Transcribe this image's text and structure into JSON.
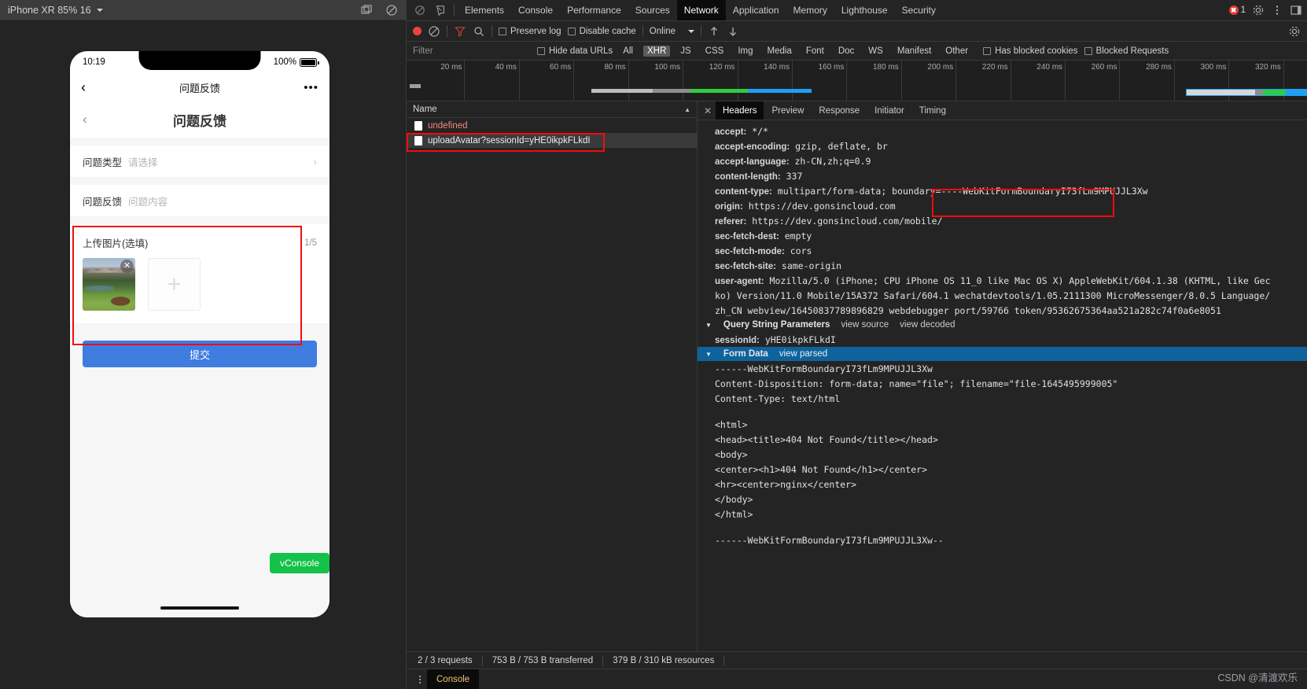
{
  "device_toolbar": {
    "device_label": "iPhone XR 85% 16",
    "rotate_icon": "rotate-icon",
    "screenshot_icon": "screenshot-icon",
    "no_throttle_icon": "no-throttling-icon"
  },
  "phone": {
    "status": {
      "time": "10:19",
      "battery_percent": "100%"
    },
    "wechat_nav": {
      "back": "‹",
      "title": "问题反馈",
      "menu": "•••"
    },
    "page": {
      "back": "‹",
      "title": "问题反馈",
      "rows": [
        {
          "label": "问题类型",
          "value": "请选择",
          "chevron": "›"
        },
        {
          "label": "问题反馈",
          "value": "问题内容",
          "chevron": ""
        }
      ],
      "upload": {
        "title": "上传图片(选填)",
        "count": "1/5",
        "remove_icon": "✕",
        "add_icon": "+"
      },
      "submit_label": "提交",
      "vconsole_label": "vConsole"
    }
  },
  "devtools": {
    "tabs": [
      {
        "label": "Elements",
        "active": false
      },
      {
        "label": "Console",
        "active": false
      },
      {
        "label": "Performance",
        "active": false
      },
      {
        "label": "Sources",
        "active": false
      },
      {
        "label": "Network",
        "active": true
      },
      {
        "label": "Application",
        "active": false
      },
      {
        "label": "Memory",
        "active": false
      },
      {
        "label": "Lighthouse",
        "active": false
      },
      {
        "label": "Security",
        "active": false
      }
    ],
    "error_count": "1",
    "inspect_icon": "inspect-icon",
    "device_toggle_icon": "device-toolbar-icon",
    "settings_icon": "settings-gear-icon",
    "more_icon": "more-vertical-icon",
    "dock_icon": "dock-side-icon",
    "network_toolbar": {
      "record_icon": "record-button",
      "clear_icon": "clear-icon",
      "filter_icon": "filter-funnel-icon",
      "search_icon": "search-icon",
      "preserve_log": "Preserve log",
      "disable_cache": "Disable cache",
      "throttle_value": "Online",
      "import_icon": "import-har-icon",
      "export_icon": "export-har-icon",
      "settings_icon": "network-settings-icon"
    },
    "filter_row": {
      "placeholder": "Filter",
      "hide_data_urls": "Hide data URLs",
      "types": [
        {
          "label": "All",
          "active": false
        },
        {
          "label": "XHR",
          "active": true
        },
        {
          "label": "JS",
          "active": false
        },
        {
          "label": "CSS",
          "active": false
        },
        {
          "label": "Img",
          "active": false
        },
        {
          "label": "Media",
          "active": false
        },
        {
          "label": "Font",
          "active": false
        },
        {
          "label": "Doc",
          "active": false
        },
        {
          "label": "WS",
          "active": false
        },
        {
          "label": "Manifest",
          "active": false
        },
        {
          "label": "Other",
          "active": false
        }
      ],
      "has_blocked_cookies": "Has blocked cookies",
      "blocked_requests": "Blocked Requests"
    },
    "overview": {
      "ticks": [
        "20 ms",
        "40 ms",
        "60 ms",
        "80 ms",
        "100 ms",
        "120 ms",
        "140 ms",
        "160 ms",
        "180 ms",
        "200 ms",
        "220 ms",
        "240 ms",
        "260 ms",
        "280 ms",
        "300 ms",
        "320 ms"
      ]
    },
    "request_list": {
      "column_header": "Name",
      "sort_indicator": "▲",
      "rows": [
        {
          "name": "undefined",
          "error": true,
          "selected": false
        },
        {
          "name": "uploadAvatar?sessionId=yHE0ikpkFLkdI",
          "error": false,
          "selected": true
        }
      ]
    },
    "detail_tabs": [
      {
        "label": "Headers",
        "active": true
      },
      {
        "label": "Preview",
        "active": false
      },
      {
        "label": "Response",
        "active": false
      },
      {
        "label": "Initiator",
        "active": false
      },
      {
        "label": "Timing",
        "active": false
      }
    ],
    "headers": [
      {
        "name": "accept:",
        "value": " */*"
      },
      {
        "name": "accept-encoding:",
        "value": " gzip, deflate, br"
      },
      {
        "name": "accept-language:",
        "value": " zh-CN,zh;q=0.9"
      },
      {
        "name": "content-length:",
        "value": " 337"
      },
      {
        "name": "content-type:",
        "value": " multipart/form-data; boundary=----WebKitFormBoundaryI73fLm9MPUJJL3Xw"
      },
      {
        "name": "origin:",
        "value": " https://dev.gonsincloud.com"
      },
      {
        "name": "referer:",
        "value": " https://dev.gonsincloud.com/mobile/"
      },
      {
        "name": "sec-fetch-dest:",
        "value": " empty"
      },
      {
        "name": "sec-fetch-mode:",
        "value": " cors"
      },
      {
        "name": "sec-fetch-site:",
        "value": " same-origin"
      },
      {
        "name": "user-agent:",
        "value": " Mozilla/5.0 (iPhone; CPU iPhone OS 11_0 like Mac OS X) AppleWebKit/604.1.38 (KHTML, like Gec"
      }
    ],
    "ua_wrap_lines": [
      "ko) Version/11.0 Mobile/15A372 Safari/604.1 wechatdevtools/1.05.2111300 MicroMessenger/8.0.5 Language/",
      "zh_CN webview/16450837789896829 webdebugger port/59766 token/95362675364aa521a282c74f0a6e8051"
    ],
    "query_string": {
      "title": "Query String Parameters",
      "view_source": "view source",
      "view_decoded": "view decoded",
      "param_name": "sessionId:",
      "param_value": " yHE0ikpkFLkdI"
    },
    "form_data": {
      "title": "Form Data",
      "view_parsed": "view parsed",
      "lines": [
        "------WebKitFormBoundaryI73fLm9MPUJJL3Xw",
        "Content-Disposition: form-data; name=\"file\"; filename=\"file-1645495999005\"",
        "Content-Type: text/html",
        "",
        "<html>",
        "<head><title>404 Not Found</title></head>",
        "<body>",
        "<center><h1>404 Not Found</h1></center>",
        "<hr><center>nginx</center>",
        "</body>",
        "</html>",
        "",
        "------WebKitFormBoundaryI73fLm9MPUJJL3Xw--"
      ]
    },
    "status_bar": [
      "2 / 3 requests",
      "753 B / 753 B transferred",
      "379 B / 310 kB resources"
    ],
    "drawer_tab": "Console"
  },
  "watermark": "CSDN @清渡欢乐",
  "colors": {
    "accent_blue": "#0e639c",
    "error_red": "#f10c0c",
    "submit_blue": "#3e7ce0",
    "vconsole_green": "#14c24a"
  }
}
